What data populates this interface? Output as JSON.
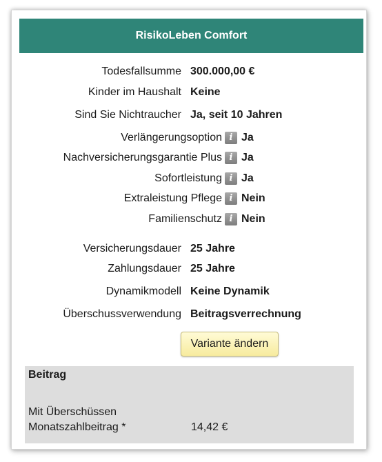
{
  "header": {
    "title": "RisikoLeben Comfort"
  },
  "rows": [
    {
      "label": "Todesfallsumme",
      "value": "300.000,00 €"
    },
    {
      "label": "Kinder im Haushalt",
      "value": "Keine"
    },
    {
      "label": "Sind Sie Nichtraucher",
      "value": "Ja, seit 10 Jahren"
    }
  ],
  "options": [
    {
      "label": "Verlängerungsoption",
      "value": "Ja",
      "icon": "info-icon"
    },
    {
      "label": "Nachversicherungsgarantie Plus",
      "value": "Ja",
      "icon": "info-icon"
    },
    {
      "label": "Sofortleistung",
      "value": "Ja",
      "icon": "info-icon"
    },
    {
      "label": "Extraleistung Pflege",
      "value": "Nein",
      "icon": "info-icon"
    },
    {
      "label": "Familienschutz",
      "value": "Nein",
      "icon": "info-icon"
    }
  ],
  "terms": [
    {
      "label": "Versicherungsdauer",
      "value": "25 Jahre"
    },
    {
      "label": "Zahlungsdauer",
      "value": "25 Jahre"
    },
    {
      "label": "Dynamikmodell",
      "value": "Keine Dynamik"
    },
    {
      "label": "Überschussverwendung",
      "value": "Beitragsverrechnung"
    }
  ],
  "info_glyph": "i",
  "button": {
    "label": "Variante ändern"
  },
  "beitrag": {
    "title": "Beitrag",
    "line1": "Mit Überschüssen",
    "line2": "Monatszahlbeitrag *",
    "amount": "14,42 €"
  },
  "colors": {
    "header_bg": "#2f8578",
    "header_text": "#ffffff",
    "button_bg": "#f7eb9e",
    "beitrag_bg": "#dddddd",
    "info_icon": "#8c8c8c"
  }
}
